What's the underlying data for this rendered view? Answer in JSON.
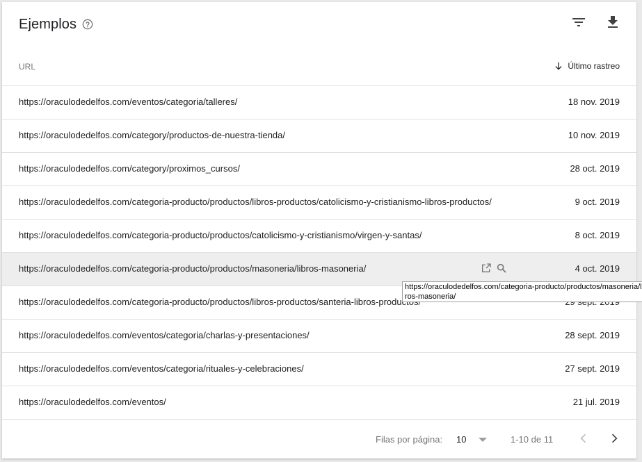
{
  "header": {
    "title": "Ejemplos"
  },
  "columns": {
    "url": "URL",
    "date": "Último rastreo"
  },
  "rows": [
    {
      "url": "https://oraculodedelfos.com/eventos/categoria/talleres/",
      "date": "18 nov. 2019"
    },
    {
      "url": "https://oraculodedelfos.com/category/productos-de-nuestra-tienda/",
      "date": "10 nov. 2019"
    },
    {
      "url": "https://oraculodedelfos.com/category/proximos_cursos/",
      "date": "28 oct. 2019"
    },
    {
      "url": "https://oraculodedelfos.com/categoria-producto/productos/libros-productos/catolicismo-y-cristianismo-libros-productos/",
      "date": "9 oct. 2019"
    },
    {
      "url": "https://oraculodedelfos.com/categoria-producto/productos/catolicismo-y-cristianismo/virgen-y-santas/",
      "date": "8 oct. 2019"
    },
    {
      "url": "https://oraculodedelfos.com/categoria-producto/productos/masoneria/libros-masoneria/",
      "date": "4 oct. 2019"
    },
    {
      "url": "https://oraculodedelfos.com/categoria-producto/productos/libros-productos/santeria-libros-productos/",
      "date": "29 sept. 2019"
    },
    {
      "url": "https://oraculodedelfos.com/eventos/categoria/charlas-y-presentaciones/",
      "date": "28 sept. 2019"
    },
    {
      "url": "https://oraculodedelfos.com/eventos/categoria/rituales-y-celebraciones/",
      "date": "27 sept. 2019"
    },
    {
      "url": "https://oraculodedelfos.com/eventos/",
      "date": "21 jul. 2019"
    }
  ],
  "tooltip": {
    "text": "https://oraculodedelfos.com/categoria-producto/productos/masoneria/libros-masoneria/"
  },
  "footer": {
    "rows_per_page_label": "Filas por página:",
    "rows_per_page_value": "10",
    "range": "1-10 de 11"
  },
  "icons": {
    "help": "help-icon",
    "filter": "filter-icon",
    "download": "download-icon",
    "sort": "arrow-down-icon",
    "open": "open-in-new-icon",
    "inspect": "search-icon",
    "prev": "chevron-left-icon",
    "next": "chevron-right-icon"
  },
  "colors": {
    "text": "#212121",
    "muted": "#757575",
    "divider": "#e0e0e0",
    "hover_row": "#eeeeee"
  }
}
